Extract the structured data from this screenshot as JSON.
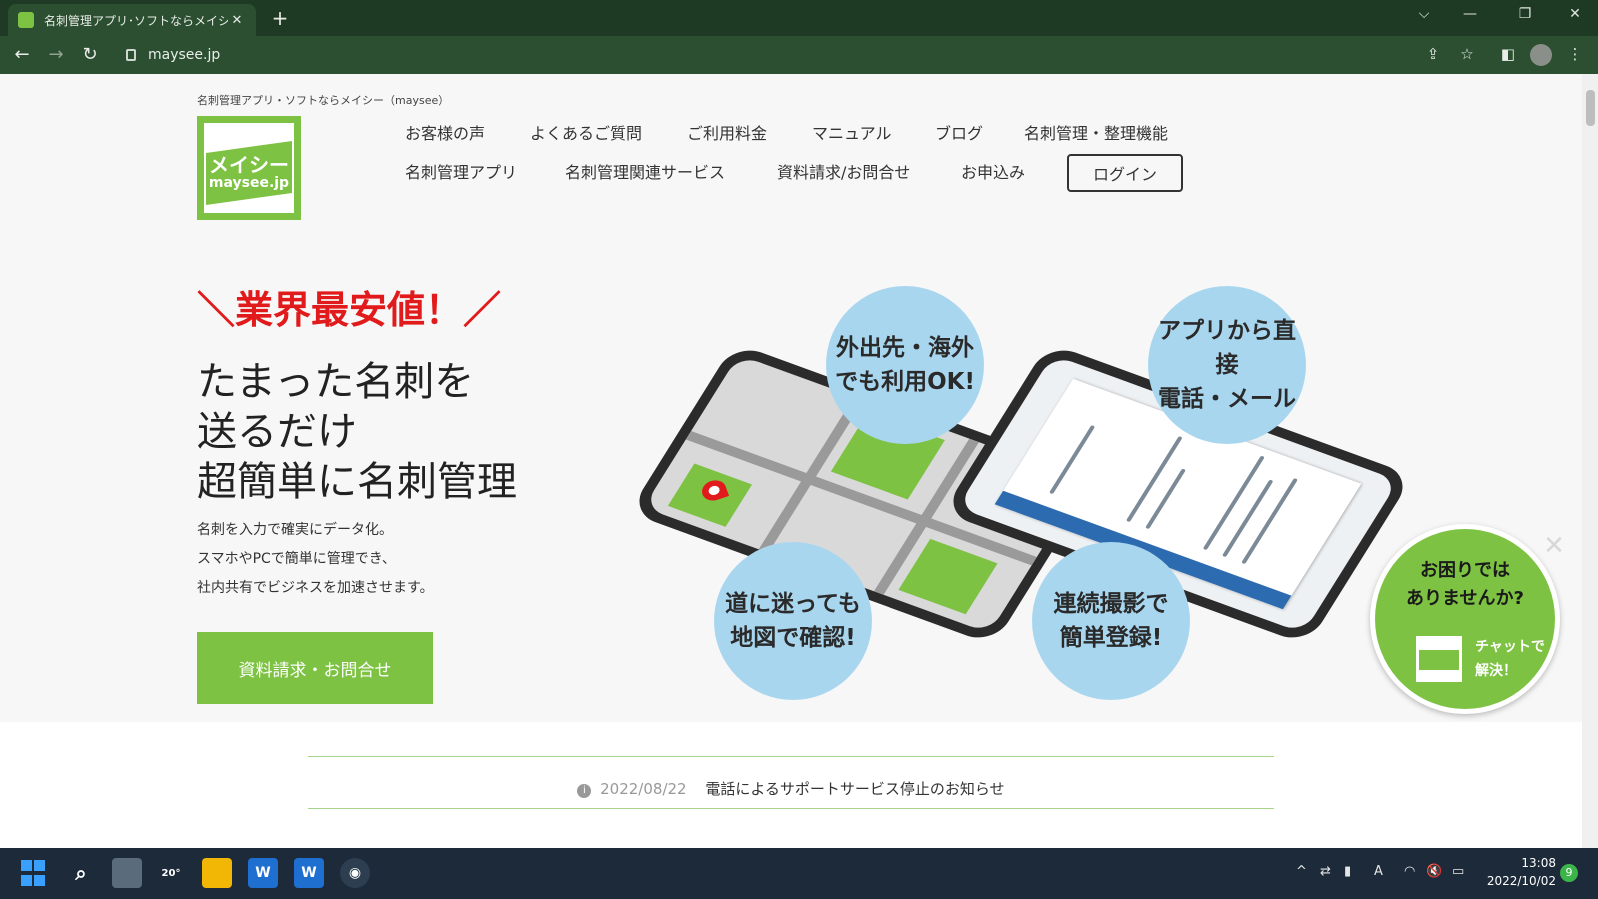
{
  "browser": {
    "tab_title": "名刺管理アプリ･ソフトならメイシー（m",
    "tab_close": "✕",
    "new_tab": "+",
    "url": "maysee.jp",
    "window_controls": [
      "⌵",
      "—",
      "❐",
      "✕"
    ],
    "nav": {
      "back": "←",
      "forward": "→",
      "reload": "↻"
    },
    "toolbar_icons": [
      "share-icon",
      "star-icon",
      "sidepanel-icon",
      "profile-icon",
      "menu-icon"
    ]
  },
  "site": {
    "tagline": "名刺管理アプリ・ソフトならメイシー（maysee）",
    "logo": {
      "ja": "メイシー",
      "en": "maysee.jp"
    },
    "nav_row1": [
      "お客様の声",
      "よくあるご質問",
      "ご利用料金",
      "マニュアル",
      "ブログ",
      "名刺管理・整理機能"
    ],
    "nav_row2": [
      "名刺管理アプリ",
      "名刺管理関連サービス",
      "資料請求/お問合せ",
      "お申込み"
    ],
    "login": "ログイン"
  },
  "hero": {
    "catch": "＼業界最安値！／",
    "headline": [
      "たまった名刺を",
      "送るだけ",
      "超簡単に名刺管理"
    ],
    "description": [
      "名刺を入力で確実にデータ化。",
      "スマホやPCで簡単に管理でき、",
      "社内共有でビジネスを加速させます。"
    ],
    "cta": "資料請求・お問合せ",
    "bubbles": [
      [
        "外出先・海外",
        "でも利用OK!"
      ],
      [
        "アプリから直接",
        "電話・メール"
      ],
      [
        "道に迷っても",
        "地図で確認!"
      ],
      [
        "連続撮影で",
        "簡単登録!"
      ]
    ]
  },
  "chat": {
    "question": [
      "お困りでは",
      "ありませんか?"
    ],
    "action": [
      "チャットで",
      "解決！"
    ],
    "close": "✕"
  },
  "news": {
    "date": "2022/08/22",
    "text": "電話によるサポートサービス停止のお知らせ"
  },
  "taskbar": {
    "weather": "20°",
    "clock_time": "13:08",
    "clock_date": "2022/10/02",
    "notifications": "9",
    "tray_ime": "A"
  },
  "colors": {
    "brand_green": "#7dc242",
    "catch_red": "#e11b1b",
    "bubble_blue": "#a9d6ef",
    "chrome_dark": "#1f3a24"
  }
}
